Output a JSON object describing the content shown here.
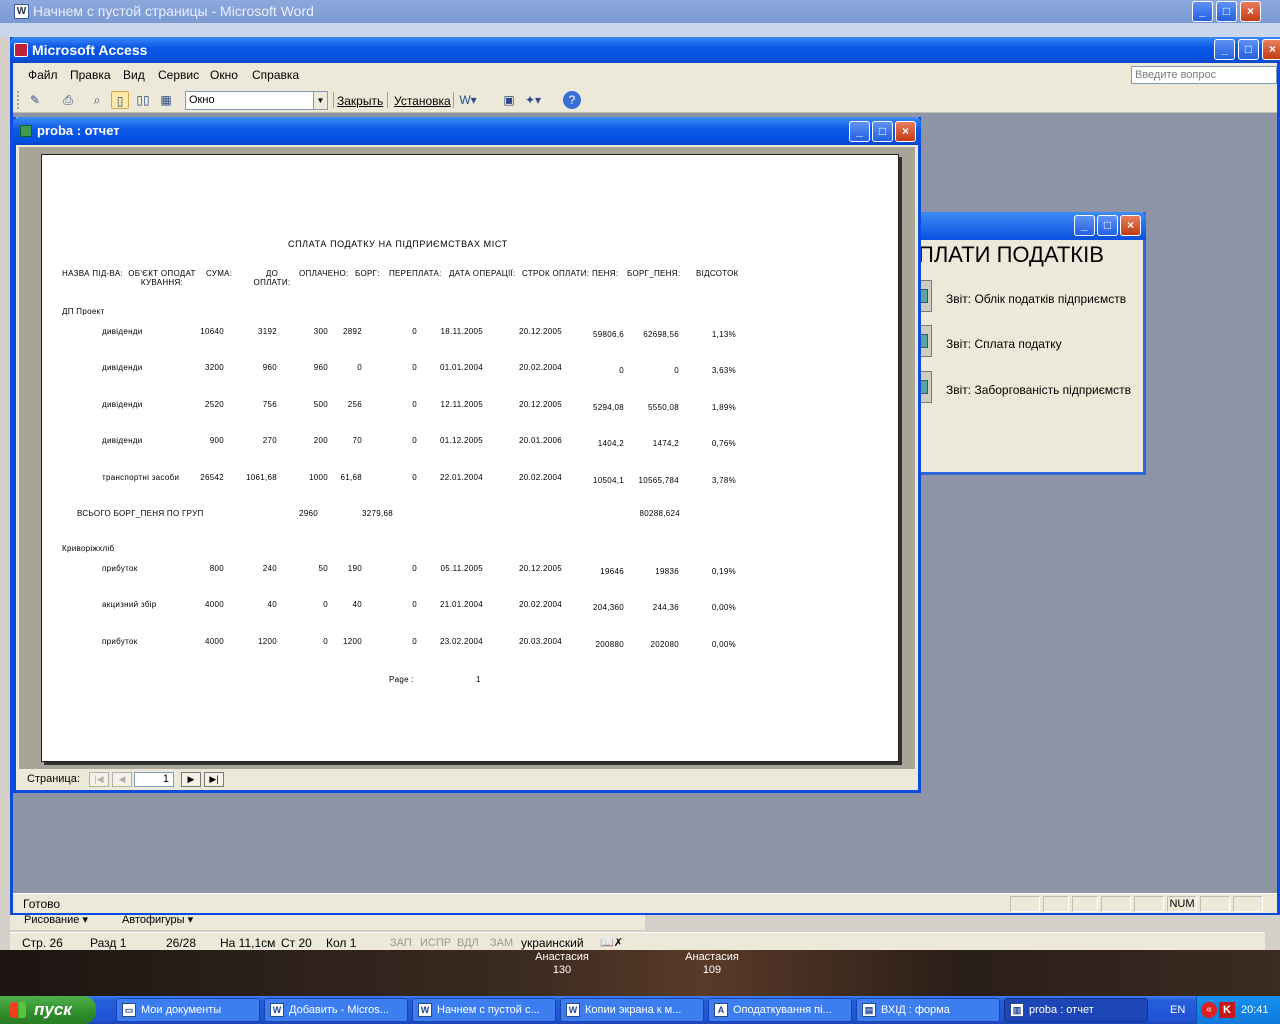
{
  "word": {
    "title": "Начнем с пустой страницы - Microsoft Word",
    "drawbar": {
      "drawing": "Рисование ▾",
      "autoshapes": "Автофигуры ▾"
    },
    "status": {
      "page": "Стр. 26",
      "section": "Разд 1",
      "pages": "26/28",
      "at": "На 11,1см",
      "line": "Ст 20",
      "col": "Кол 1",
      "rec": "ЗАП",
      "trk": "ИСПР",
      "ext": "ВДЛ",
      "ovr": "ЗАМ",
      "lang": "украинский"
    }
  },
  "access": {
    "title": "Microsoft Access",
    "menu": [
      "Файл",
      "Правка",
      "Вид",
      "Сервис",
      "Окно",
      "Справка"
    ],
    "ask_placeholder": "Введите вопрос",
    "toolbar": {
      "zoom_combo": "Окно",
      "close_label": "Закрыть",
      "setup_label": "Установка"
    },
    "status": {
      "ready": "Готово",
      "num": "NUM"
    }
  },
  "form": {
    "heading": "ПЛАТИ ПОДАТКІВ",
    "buttons": [
      "Звіт: Облік податків підприємств",
      "Звіт: Сплата податку",
      "Звіт: Заборгованість підприємств"
    ]
  },
  "report_window": {
    "title": "proba : отчет",
    "nav_label": "Страница:",
    "page_value": "1"
  },
  "report": {
    "title": "СПЛАТА ПОДАТКУ НА ПІДПРИЄМСТВАХ МІСТ",
    "headers": [
      "НАЗВА ПІД-ВА:",
      "ОБ'ЄКТ ОПОДАТ КУВАННЯ:",
      "СУМА:",
      "ДО ОПЛАТИ:",
      "ОПЛАЧЕНО:",
      "БОРГ:",
      "ПЕРЕПЛАТА:",
      "ДАТА ОПЕРАЦІЇ:",
      "СТРОК ОПЛАТИ:",
      "ПЕНЯ:",
      "БОРГ_ПЕНЯ:",
      "ВІДСОТОК"
    ],
    "group1": {
      "name": "ДП Проект",
      "rows": [
        [
          "дивіденди",
          "10640",
          "3192",
          "300",
          "2892",
          "0",
          "18.11.2005",
          "20.12.2005",
          "59806,6",
          "62698,56",
          "1,13%"
        ],
        [
          "дивіденди",
          "3200",
          "960",
          "960",
          "0",
          "0",
          "01.01.2004",
          "20.02.2004",
          "0",
          "0",
          "3,63%"
        ],
        [
          "дивіденди",
          "2520",
          "756",
          "500",
          "256",
          "0",
          "12.11.2005",
          "20.12.2005",
          "5294,08",
          "5550,08",
          "1,89%"
        ],
        [
          "дивіденди",
          "900",
          "270",
          "200",
          "70",
          "0",
          "01.12.2005",
          "20.01.2006",
          "1404,2",
          "1474,2",
          "0,76%"
        ],
        [
          "транспортні засоби",
          "26542",
          "1061,68",
          "1000",
          "61,68",
          "0",
          "22.01.2004",
          "20.02.2004",
          "10504,1",
          "10565,784",
          "3,78%"
        ]
      ],
      "total_label": "ВСЬОГО БОРГ_ПЕНЯ ПО ГРУП",
      "total_paid": "2960",
      "total_debt": "3279,68",
      "total_penalty_debt": "80288,624"
    },
    "group2": {
      "name": "Криворіжхліб",
      "rows": [
        [
          "прибуток",
          "800",
          "240",
          "50",
          "190",
          "0",
          "05.11.2005",
          "20.12.2005",
          "19646",
          "19836",
          "0,19%"
        ],
        [
          "акцизний збір",
          "4000",
          "40",
          "0",
          "40",
          "0",
          "21.01.2004",
          "20.02.2004",
          "204,360",
          "244,36",
          "0,00%"
        ],
        [
          "прибуток",
          "4000",
          "1200",
          "0",
          "1200",
          "0",
          "23.02.2004",
          "20.03.2004",
          "200880",
          "202080",
          "0,00%"
        ]
      ]
    },
    "footer": {
      "page_label": "Page :",
      "page_num": "1"
    }
  },
  "desktop": {
    "icons": [
      {
        "label": "Анастасия 130"
      },
      {
        "label": "Анастасия 109"
      }
    ]
  },
  "taskbar": {
    "start": "пуск",
    "tasks": [
      "Мои документы",
      "Добавить - Micros...",
      "Начнем с пустой с...",
      "Копии экрана к м...",
      "Оподаткування пі...",
      "ВХІД : форма",
      "proba : отчет"
    ],
    "lang": "EN",
    "clock": "20:41"
  }
}
